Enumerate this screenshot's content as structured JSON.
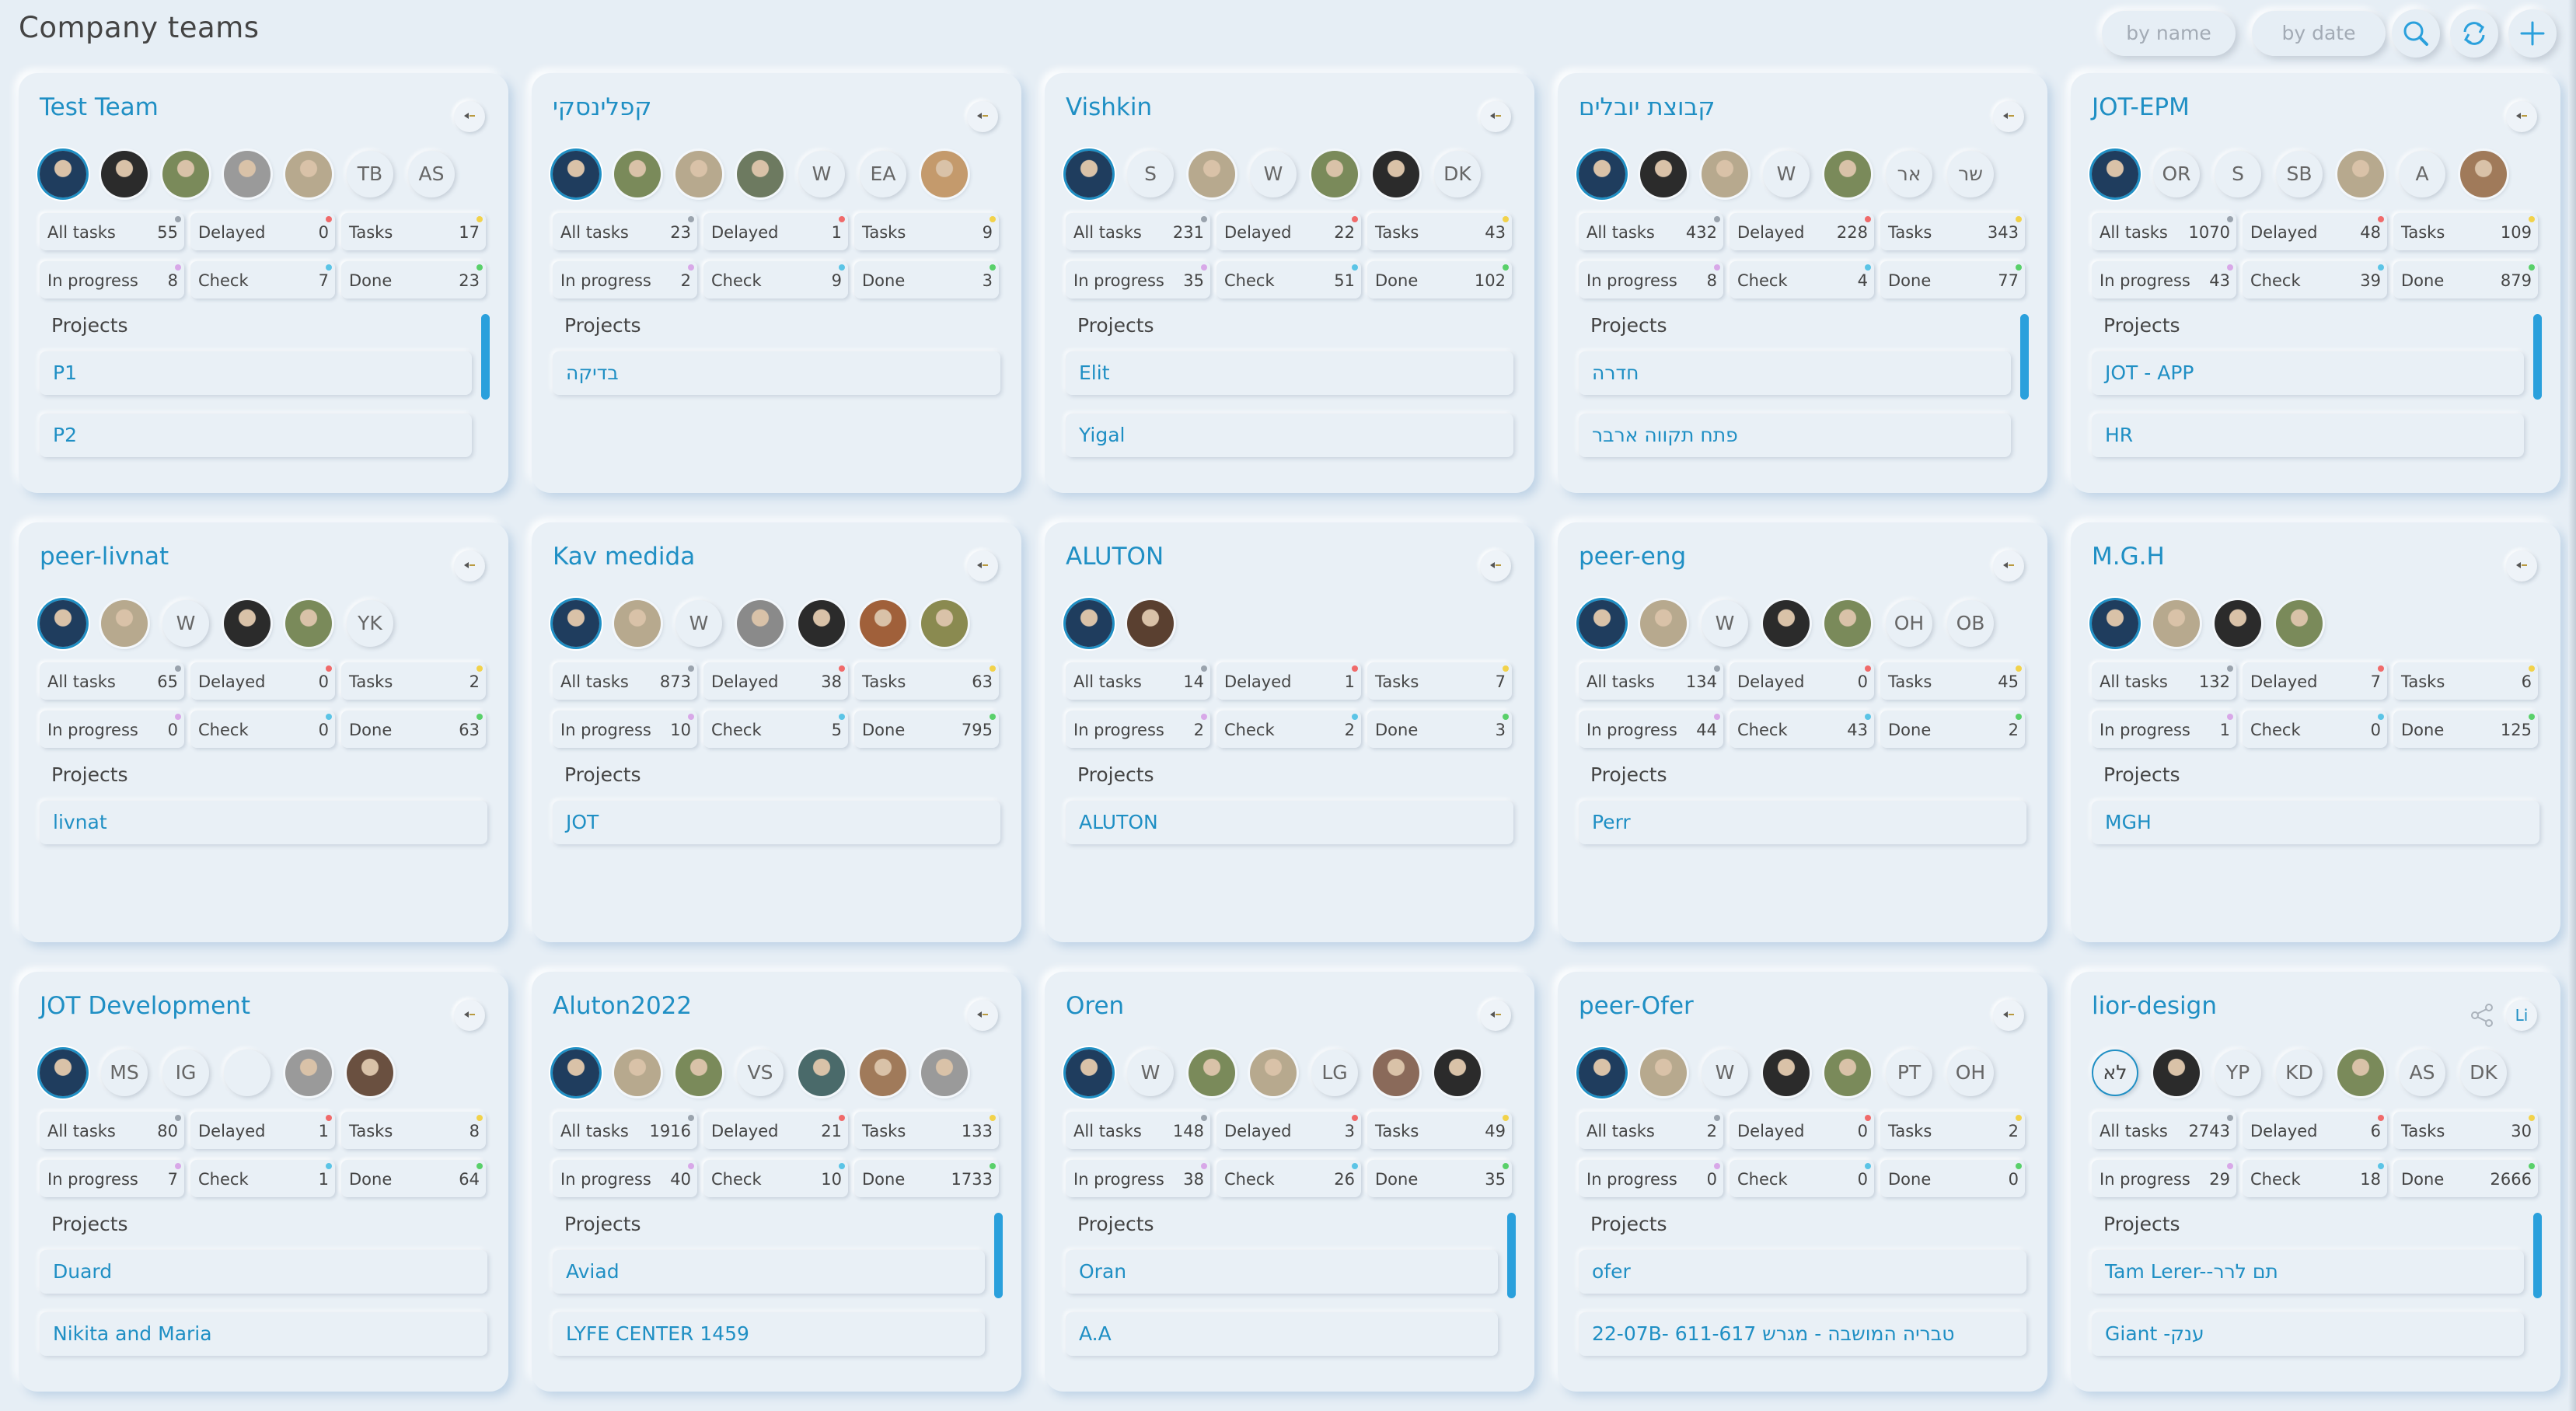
{
  "header": {
    "title": "Company teams",
    "sort_by_name": "by name",
    "sort_by_date": "by date",
    "icons": [
      "search-icon",
      "refresh-icon",
      "add-icon"
    ]
  },
  "colors": {
    "accent": "#1f8fc4",
    "dot_all": "#9aa3ad",
    "dot_delayed": "#f06a6a",
    "dot_tasks": "#f2d24a",
    "dot_progress": "#d8a8e8",
    "dot_check": "#5bc4e6",
    "dot_done": "#59d06a"
  },
  "labels": {
    "all_tasks": "All tasks",
    "delayed": "Delayed",
    "tasks": "Tasks",
    "in_progress": "In progress",
    "check": "Check",
    "done": "Done",
    "projects": "Projects"
  },
  "teams": [
    {
      "name": "Test Team",
      "action_icon": "team-action-icon",
      "members": [
        {
          "type": "photo",
          "color": "#1f3d5e"
        },
        {
          "type": "photo",
          "color": "#2b2b2b"
        },
        {
          "type": "photo",
          "color": "#7a8a5a"
        },
        {
          "type": "photo",
          "color": "#9a9a9a"
        },
        {
          "type": "photo",
          "color": "#b7a98e"
        },
        {
          "type": "initials",
          "text": "TB"
        },
        {
          "type": "initials",
          "text": "AS"
        }
      ],
      "stats": {
        "all": "55",
        "delayed": "0",
        "tasks": "17",
        "progress": "8",
        "check": "7",
        "done": "23"
      },
      "projects": [
        "P1",
        "P2"
      ],
      "scroll": true
    },
    {
      "name": "קפלינסקי",
      "action_icon": "team-action-icon",
      "members": [
        {
          "type": "photo",
          "color": "#1f3d5e"
        },
        {
          "type": "photo",
          "color": "#7a8a5a"
        },
        {
          "type": "photo",
          "color": "#b7a98e"
        },
        {
          "type": "photo",
          "color": "#6d7a60"
        },
        {
          "type": "initials",
          "text": "W"
        },
        {
          "type": "initials",
          "text": "EA"
        },
        {
          "type": "photo",
          "color": "#c49a6c"
        }
      ],
      "stats": {
        "all": "23",
        "delayed": "1",
        "tasks": "9",
        "progress": "2",
        "check": "9",
        "done": "3"
      },
      "projects": [
        "בדיקה"
      ],
      "scroll": false
    },
    {
      "name": "Vishkin",
      "action_icon": "team-action-icon",
      "members": [
        {
          "type": "photo",
          "color": "#1f3d5e"
        },
        {
          "type": "initials",
          "text": "S"
        },
        {
          "type": "photo",
          "color": "#b7a98e"
        },
        {
          "type": "initials",
          "text": "W"
        },
        {
          "type": "photo",
          "color": "#7a8a5a"
        },
        {
          "type": "photo",
          "color": "#2b2b2b"
        },
        {
          "type": "initials",
          "text": "DK"
        }
      ],
      "stats": {
        "all": "231",
        "delayed": "22",
        "tasks": "43",
        "progress": "35",
        "check": "51",
        "done": "102"
      },
      "projects": [
        "Elit",
        "Yigal"
      ],
      "scroll": false
    },
    {
      "name": "קבוצת יובלים",
      "action_icon": "team-action-icon",
      "members": [
        {
          "type": "photo",
          "color": "#1f3d5e"
        },
        {
          "type": "photo",
          "color": "#2b2b2b"
        },
        {
          "type": "photo",
          "color": "#b7a98e"
        },
        {
          "type": "initials",
          "text": "W"
        },
        {
          "type": "photo",
          "color": "#7a8a5a"
        },
        {
          "type": "initials",
          "text": "אר"
        },
        {
          "type": "initials",
          "text": "שר"
        }
      ],
      "stats": {
        "all": "432",
        "delayed": "228",
        "tasks": "343",
        "progress": "8",
        "check": "4",
        "done": "77"
      },
      "projects": [
        "חדרה",
        "פתח תקווה ארבר"
      ],
      "scroll": true
    },
    {
      "name": "JOT-EPM",
      "action_icon": "team-action-icon",
      "members": [
        {
          "type": "photo",
          "color": "#1f3d5e"
        },
        {
          "type": "initials",
          "text": "OR"
        },
        {
          "type": "initials",
          "text": "S"
        },
        {
          "type": "initials",
          "text": "SB"
        },
        {
          "type": "photo",
          "color": "#b7a98e"
        },
        {
          "type": "initials",
          "text": "A"
        },
        {
          "type": "photo",
          "color": "#a07a5a"
        }
      ],
      "stats": {
        "all": "1070",
        "delayed": "48",
        "tasks": "109",
        "progress": "43",
        "check": "39",
        "done": "879"
      },
      "projects": [
        "JOT - APP",
        "HR"
      ],
      "scroll": true
    },
    {
      "name": "peer-livnat",
      "action_icon": "team-action-icon",
      "members": [
        {
          "type": "photo",
          "color": "#1f3d5e"
        },
        {
          "type": "photo",
          "color": "#b7a98e"
        },
        {
          "type": "initials",
          "text": "W"
        },
        {
          "type": "photo",
          "color": "#2b2b2b"
        },
        {
          "type": "photo",
          "color": "#7a8a5a"
        },
        {
          "type": "initials",
          "text": "YK"
        }
      ],
      "stats": {
        "all": "65",
        "delayed": "0",
        "tasks": "2",
        "progress": "0",
        "check": "0",
        "done": "63"
      },
      "projects": [
        "livnat"
      ],
      "scroll": false
    },
    {
      "name": "Kav medida",
      "action_icon": "team-action-icon",
      "members": [
        {
          "type": "photo",
          "color": "#1f3d5e"
        },
        {
          "type": "photo",
          "color": "#b7a98e"
        },
        {
          "type": "initials",
          "text": "W"
        },
        {
          "type": "photo",
          "color": "#8a8a8a"
        },
        {
          "type": "photo",
          "color": "#2b2b2b"
        },
        {
          "type": "photo",
          "color": "#a0603a"
        },
        {
          "type": "photo",
          "color": "#8a8a50"
        }
      ],
      "stats": {
        "all": "873",
        "delayed": "38",
        "tasks": "63",
        "progress": "10",
        "check": "5",
        "done": "795"
      },
      "projects": [
        "JOT"
      ],
      "scroll": false
    },
    {
      "name": "ALUTON",
      "action_icon": "team-action-icon",
      "members": [
        {
          "type": "photo",
          "color": "#1f3d5e"
        },
        {
          "type": "photo",
          "color": "#5a4030"
        }
      ],
      "stats": {
        "all": "14",
        "delayed": "1",
        "tasks": "7",
        "progress": "2",
        "check": "2",
        "done": "3"
      },
      "projects": [
        "ALUTON"
      ],
      "scroll": false
    },
    {
      "name": "peer-eng",
      "action_icon": "team-action-icon",
      "members": [
        {
          "type": "photo",
          "color": "#1f3d5e"
        },
        {
          "type": "photo",
          "color": "#b7a98e"
        },
        {
          "type": "initials",
          "text": "W"
        },
        {
          "type": "photo",
          "color": "#2b2b2b"
        },
        {
          "type": "photo",
          "color": "#7a8a5a"
        },
        {
          "type": "initials",
          "text": "OH"
        },
        {
          "type": "initials",
          "text": "OB"
        }
      ],
      "stats": {
        "all": "134",
        "delayed": "0",
        "tasks": "45",
        "progress": "44",
        "check": "43",
        "done": "2"
      },
      "projects": [
        "Perr"
      ],
      "scroll": false
    },
    {
      "name": "M.G.H",
      "action_icon": "team-action-icon",
      "members": [
        {
          "type": "photo",
          "color": "#1f3d5e"
        },
        {
          "type": "photo",
          "color": "#b7a98e"
        },
        {
          "type": "photo",
          "color": "#2b2b2b"
        },
        {
          "type": "photo",
          "color": "#7a8a5a"
        }
      ],
      "stats": {
        "all": "132",
        "delayed": "7",
        "tasks": "6",
        "progress": "1",
        "check": "0",
        "done": "125"
      },
      "projects": [
        "MGH"
      ],
      "scroll": false
    },
    {
      "name": "JOT Development",
      "action_icon": "team-action-icon",
      "members": [
        {
          "type": "photo",
          "color": "#1f3d5e"
        },
        {
          "type": "initials",
          "text": "MS"
        },
        {
          "type": "initials",
          "text": "IG"
        },
        {
          "type": "blank"
        },
        {
          "type": "photo",
          "color": "#9a9a9a"
        },
        {
          "type": "photo",
          "color": "#6a5040"
        }
      ],
      "stats": {
        "all": "80",
        "delayed": "1",
        "tasks": "8",
        "progress": "7",
        "check": "1",
        "done": "64"
      },
      "projects": [
        "Duard",
        "Nikita and Maria"
      ],
      "scroll": false
    },
    {
      "name": "Aluton2022",
      "action_icon": "team-action-icon",
      "members": [
        {
          "type": "photo",
          "color": "#1f3d5e"
        },
        {
          "type": "photo",
          "color": "#b7a98e"
        },
        {
          "type": "photo",
          "color": "#7a8a5a"
        },
        {
          "type": "initials",
          "text": "VS"
        },
        {
          "type": "photo",
          "color": "#4a6a6a"
        },
        {
          "type": "photo",
          "color": "#a07a5a"
        },
        {
          "type": "photo",
          "color": "#9a9a9a"
        }
      ],
      "stats": {
        "all": "1916",
        "delayed": "21",
        "tasks": "133",
        "progress": "40",
        "check": "10",
        "done": "1733"
      },
      "projects": [
        "Aviad",
        "LYFE CENTER 1459"
      ],
      "scroll": true
    },
    {
      "name": "Oren",
      "action_icon": "team-action-icon",
      "members": [
        {
          "type": "photo",
          "color": "#1f3d5e"
        },
        {
          "type": "initials",
          "text": "W"
        },
        {
          "type": "photo",
          "color": "#7a8a5a"
        },
        {
          "type": "photo",
          "color": "#b7a98e"
        },
        {
          "type": "initials",
          "text": "LG"
        },
        {
          "type": "photo",
          "color": "#8a6a5a"
        },
        {
          "type": "photo",
          "color": "#2b2b2b"
        }
      ],
      "stats": {
        "all": "148",
        "delayed": "3",
        "tasks": "49",
        "progress": "38",
        "check": "26",
        "done": "35"
      },
      "projects": [
        "Oran",
        "A.A"
      ],
      "scroll": true
    },
    {
      "name": "peer-Ofer",
      "action_icon": "team-action-icon",
      "members": [
        {
          "type": "photo",
          "color": "#1f3d5e"
        },
        {
          "type": "photo",
          "color": "#b7a98e"
        },
        {
          "type": "initials",
          "text": "W"
        },
        {
          "type": "photo",
          "color": "#2b2b2b"
        },
        {
          "type": "photo",
          "color": "#7a8a5a"
        },
        {
          "type": "initials",
          "text": "PT"
        },
        {
          "type": "initials",
          "text": "OH"
        }
      ],
      "stats": {
        "all": "2",
        "delayed": "0",
        "tasks": "2",
        "progress": "0",
        "check": "0",
        "done": "0"
      },
      "projects": [
        "ofer",
        "22-07B- 611-617 טבריה המושבה - מגרש"
      ],
      "scroll": false
    },
    {
      "name": "lior-design",
      "action_icon": "share-icon",
      "initials_badge": "Li",
      "members": [
        {
          "type": "outline",
          "text": "לא"
        },
        {
          "type": "photo",
          "color": "#2b2b2b"
        },
        {
          "type": "initials",
          "text": "YP"
        },
        {
          "type": "initials",
          "text": "KD"
        },
        {
          "type": "photo",
          "color": "#7a8a5a"
        },
        {
          "type": "initials",
          "text": "AS"
        },
        {
          "type": "initials",
          "text": "DK"
        }
      ],
      "stats": {
        "all": "2743",
        "delayed": "6",
        "tasks": "30",
        "progress": "29",
        "check": "18",
        "done": "2666"
      },
      "projects": [
        "Tam Lerer--תם לרר",
        "Giant -ענק"
      ],
      "scroll": true
    }
  ]
}
